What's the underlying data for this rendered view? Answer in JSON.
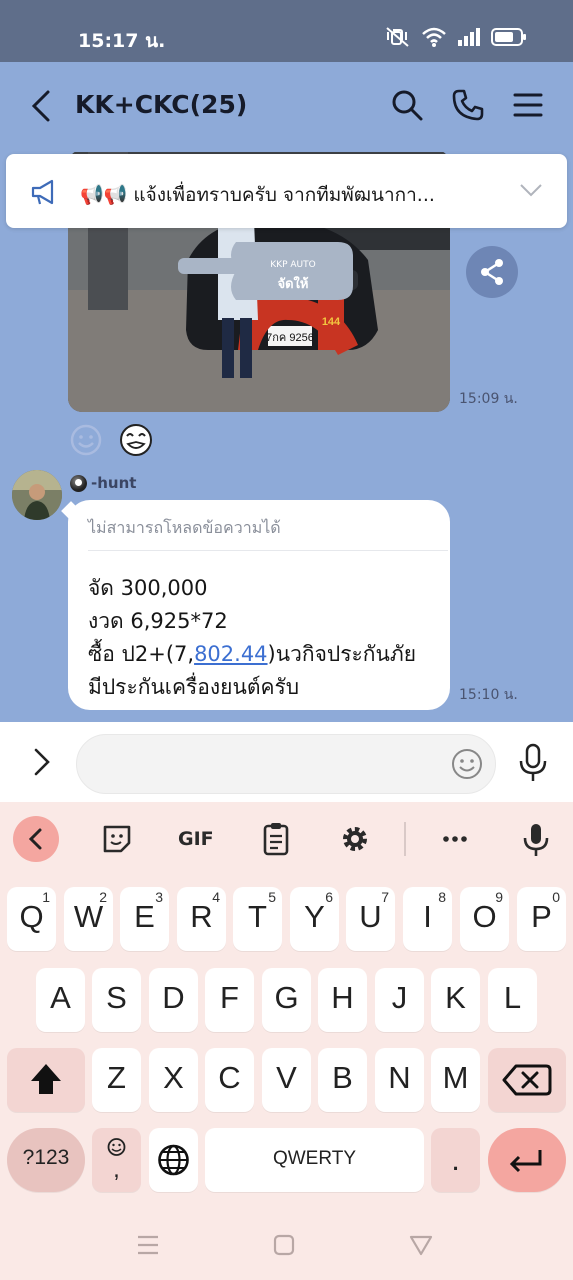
{
  "status_bar": {
    "time": "15:17 น."
  },
  "header": {
    "title": "KK+CKC(25)"
  },
  "announcement": {
    "emoji": "📢📢",
    "text": "แจ้งเพื่อทราบครับ จากทีมพัฒนากา..."
  },
  "messages": {
    "photo": {
      "time": "15:09 น.",
      "sign_brand": "KKP AUTO",
      "sign_text": "จัดให้",
      "plate": "7กค 9256",
      "ribbon_number": "144"
    },
    "text_message": {
      "sender": "-hunt",
      "quote": "ไม่สามารถโหลดข้อความได้",
      "line1": "จัด 300,000",
      "line2": "งวด 6,925*72",
      "line3_pre": "ซื้อ ป2+(7,",
      "line3_link": "802.44",
      "line3_post": ")นวกิจประกันภัย",
      "line4": "มีประกันเครื่องยนต์ครับ",
      "time": "15:10 น."
    }
  },
  "input": {
    "placeholder": ""
  },
  "keyboard": {
    "toolbar": {
      "gif": "GIF"
    },
    "row1": [
      {
        "k": "Q",
        "h": "1"
      },
      {
        "k": "W",
        "h": "2"
      },
      {
        "k": "E",
        "h": "3"
      },
      {
        "k": "R",
        "h": "4"
      },
      {
        "k": "T",
        "h": "5"
      },
      {
        "k": "Y",
        "h": "6"
      },
      {
        "k": "U",
        "h": "7"
      },
      {
        "k": "I",
        "h": "8"
      },
      {
        "k": "O",
        "h": "9"
      },
      {
        "k": "P",
        "h": "0"
      }
    ],
    "row2": [
      "A",
      "S",
      "D",
      "F",
      "G",
      "H",
      "J",
      "K",
      "L"
    ],
    "row3": [
      "Z",
      "X",
      "C",
      "V",
      "B",
      "N",
      "M"
    ],
    "symbols_key": "?123",
    "emoji_comma_key": ",",
    "space_key": "QWERTY",
    "period_key": "."
  },
  "colors": {
    "chat_bg": "#8eaad8",
    "status_bg": "#5f6e8a",
    "keyboard_bg": "#fae9e6",
    "accent_key": "#f4a6a0",
    "link": "#3c6fd1"
  }
}
